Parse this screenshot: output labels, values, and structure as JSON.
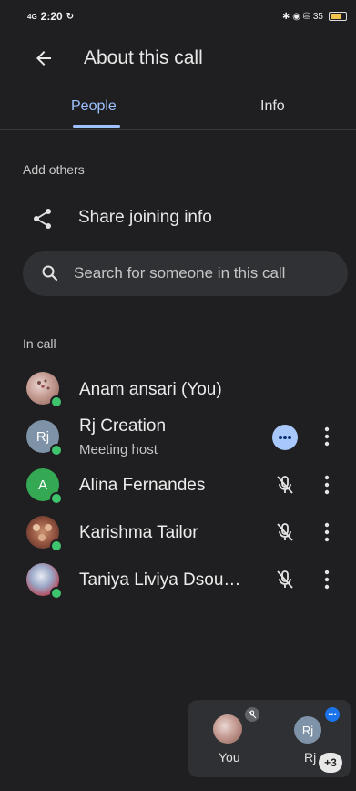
{
  "status_bar": {
    "time": "2:20",
    "signal": "4G",
    "right_text": "✱ ◉ ⛁ 35 ",
    "accent": "#f2c14e"
  },
  "header": {
    "title": "About this call",
    "back_icon": "arrow-left-icon"
  },
  "tabs": [
    {
      "label": "People",
      "active": true
    },
    {
      "label": "Info",
      "active": false
    }
  ],
  "add_others": {
    "label": "Add others",
    "share": {
      "label": "Share joining info",
      "icon": "share-icon"
    }
  },
  "search": {
    "placeholder": "Search for someone in this call",
    "value": ""
  },
  "in_call": {
    "label": "In call",
    "participants": [
      {
        "name": "Anam ansari (You)",
        "subtitle": "",
        "avatar": "photo",
        "state": "none"
      },
      {
        "name": "Rj Creation",
        "subtitle": "Meeting host",
        "avatar": "initials",
        "initials": "Rj",
        "state": "speaking"
      },
      {
        "name": "Alina Fernandes",
        "subtitle": "",
        "avatar": "initials",
        "initials": "A",
        "state": "muted"
      },
      {
        "name": "Karishma Tailor",
        "subtitle": "",
        "avatar": "photo",
        "state": "muted"
      },
      {
        "name": "Taniya Liviya Dsou…",
        "subtitle": "",
        "avatar": "photo",
        "state": "muted"
      }
    ]
  },
  "pip": {
    "you_label": "You",
    "rj_initials": "Rj",
    "rj_label": "Rj",
    "more_count": "+3"
  },
  "colors": {
    "background": "#1f1f21",
    "accent_blue": "#9ec2ff",
    "presence_green": "#3ec46d",
    "avatar_green": "#34a853",
    "avatar_gray": "#7f93a8"
  }
}
